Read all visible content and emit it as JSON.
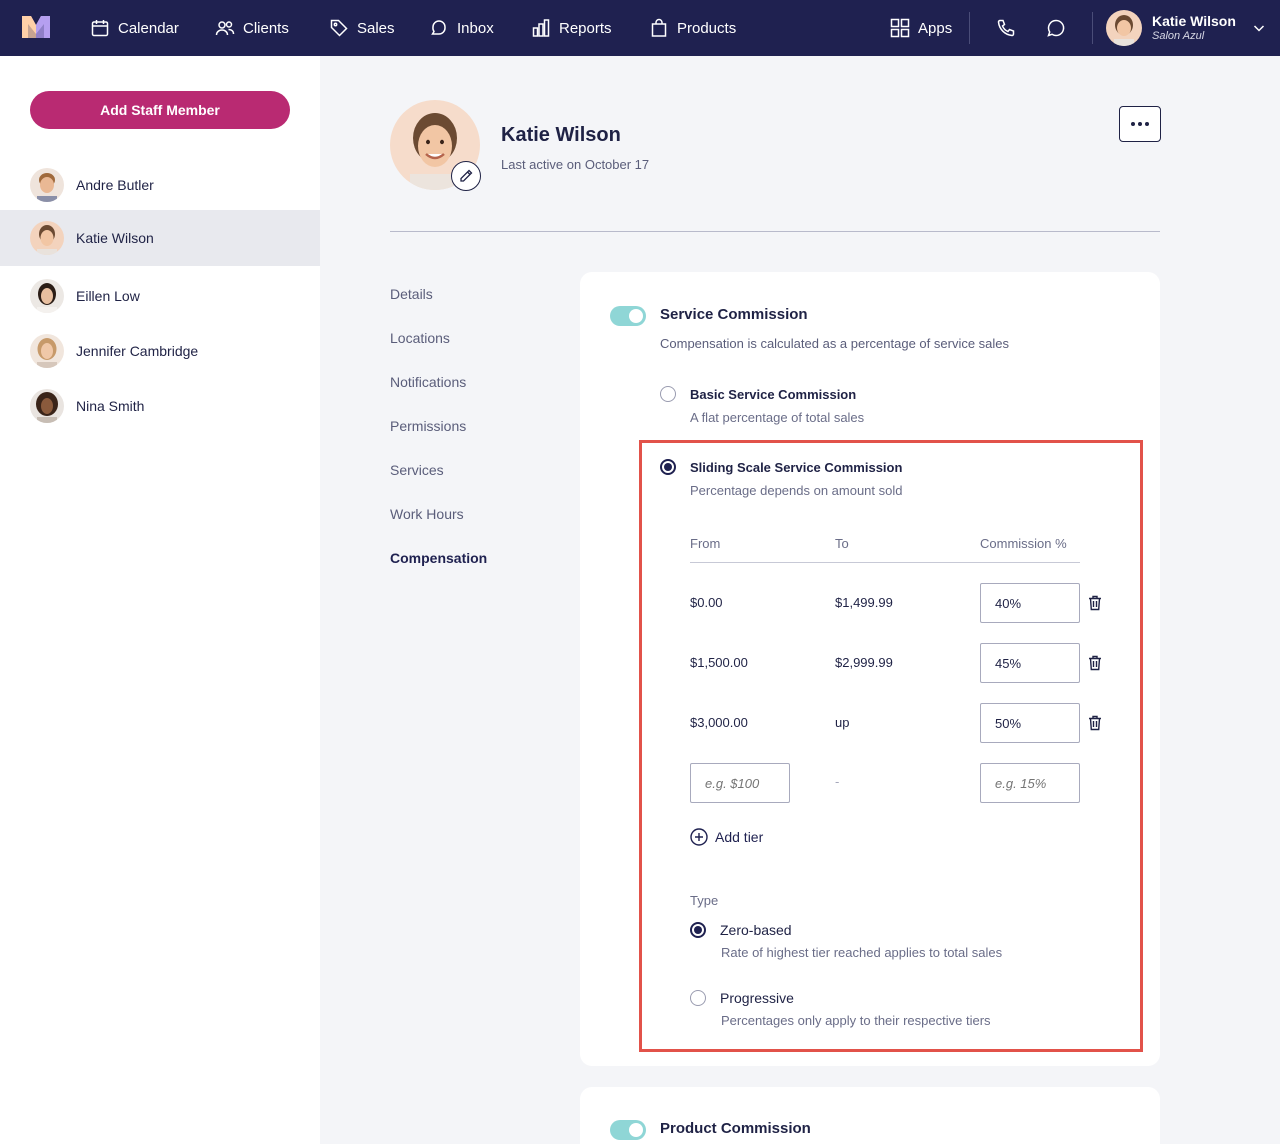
{
  "nav": {
    "items": [
      {
        "label": "Calendar",
        "icon": "calendar-icon"
      },
      {
        "label": "Clients",
        "icon": "users-icon"
      },
      {
        "label": "Sales",
        "icon": "tag-icon"
      },
      {
        "label": "Inbox",
        "icon": "inbox-icon"
      },
      {
        "label": "Reports",
        "icon": "bar-chart-icon"
      },
      {
        "label": "Products",
        "icon": "shopping-bag-icon"
      }
    ],
    "apps_label": "Apps",
    "user": {
      "name": "Katie Wilson",
      "salon": "Salon Azul"
    }
  },
  "sidebar": {
    "add_button": "Add Staff Member",
    "staff": [
      "Andre Butler",
      "Katie Wilson",
      "Eillen Low",
      "Jennifer Cambridge",
      "Nina Smith"
    ],
    "active_index": 1
  },
  "profile": {
    "name": "Katie Wilson",
    "last_active": "Last active on October 17"
  },
  "subnav": {
    "items": [
      "Details",
      "Locations",
      "Notifications",
      "Permissions",
      "Services",
      "Work Hours",
      "Compensation"
    ],
    "active": "Compensation"
  },
  "service_commission": {
    "title": "Service Commission",
    "description": "Compensation is calculated as a percentage of service sales",
    "enabled": true,
    "basic": {
      "title": "Basic Service Commission",
      "description": "A flat percentage of total sales"
    },
    "sliding": {
      "title": "Sliding Scale Service Commission",
      "description": "Percentage depends on amount sold",
      "columns": [
        "From",
        "To",
        "Commission %"
      ],
      "tiers": [
        {
          "from": "$0.00",
          "to": "$1,499.99",
          "pct": "40%"
        },
        {
          "from": "$1,500.00",
          "to": "$2,999.99",
          "pct": "45%"
        },
        {
          "from": "$3,000.00",
          "to": "up",
          "pct": "50%"
        }
      ],
      "new_from_placeholder": "e.g. $100",
      "new_to": "-",
      "new_pct_placeholder": "e.g. 15%",
      "add_tier": "Add tier",
      "type_label": "Type",
      "types": [
        {
          "title": "Zero-based",
          "description": "Rate of highest tier reached applies to total sales",
          "checked": true
        },
        {
          "title": "Progressive",
          "description": "Percentages only apply to their respective tiers",
          "checked": false
        }
      ]
    }
  },
  "product_commission": {
    "title": "Product Commission",
    "enabled": true
  },
  "colors": {
    "nav_bg": "#1f2150",
    "primary_button": "#b92a72",
    "toggle_on": "#8fd6d6",
    "highlight": "#e2524a"
  }
}
